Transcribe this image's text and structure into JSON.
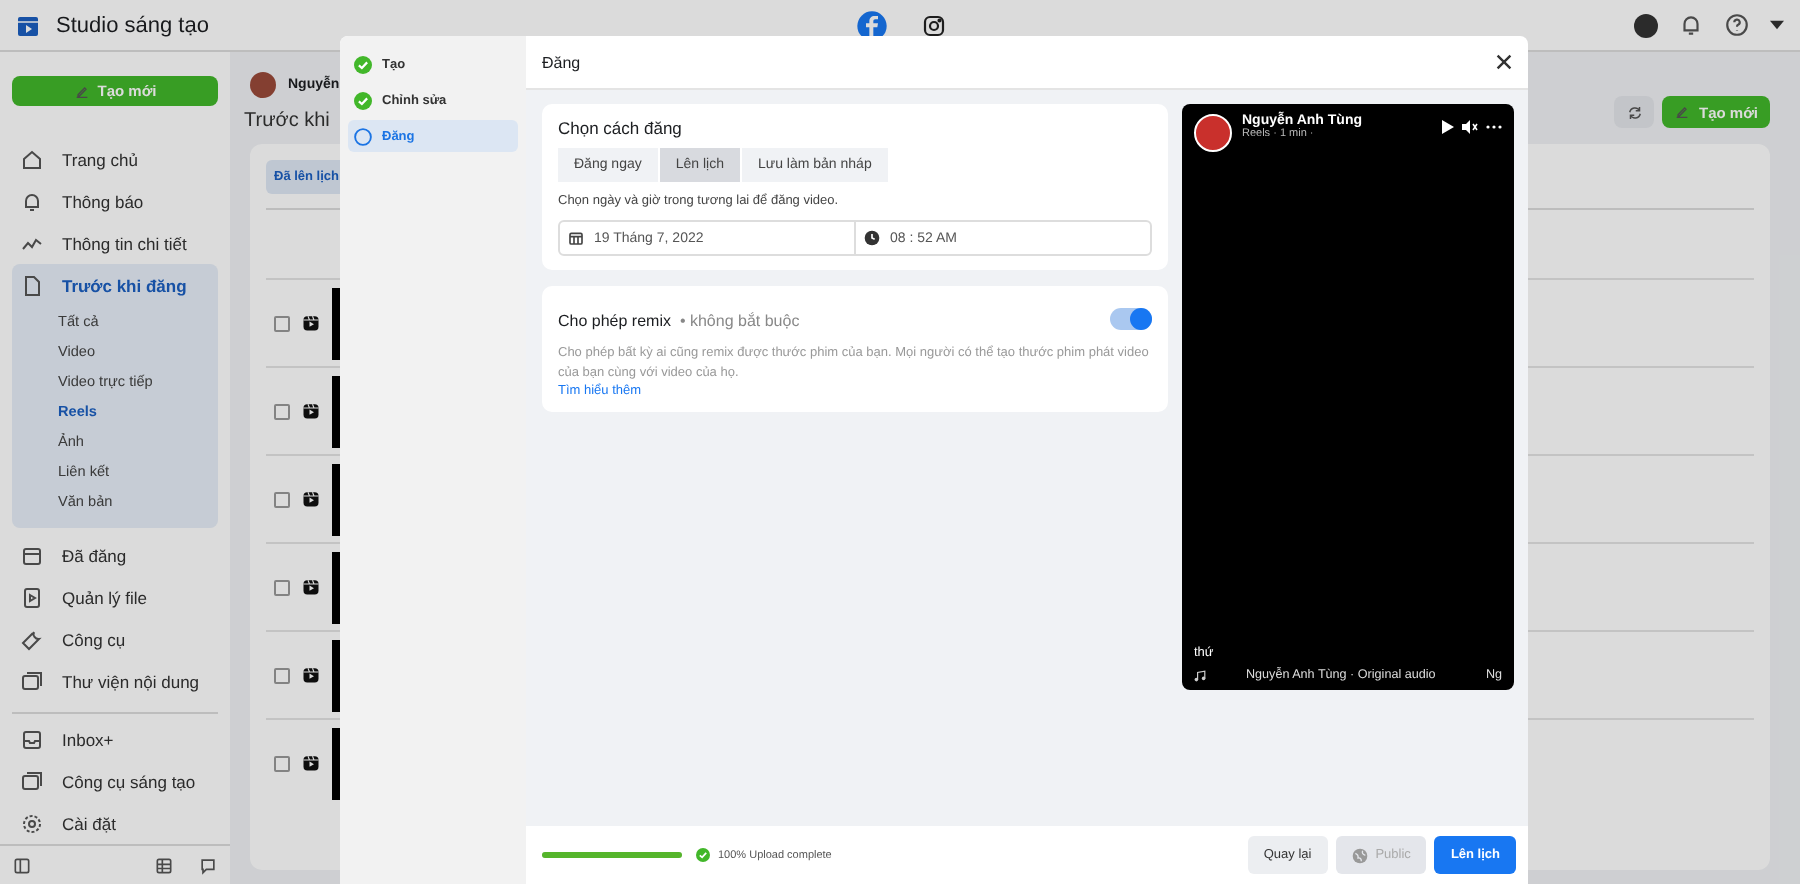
{
  "app_bar": {
    "title": "Studio sáng tạo"
  },
  "sidebar": {
    "create_button": "Tạo mới",
    "items": [
      {
        "label": "Trang chủ",
        "selected": false
      },
      {
        "label": "Thông báo",
        "selected": false
      },
      {
        "label": "Thông tin chi tiết",
        "selected": false
      },
      {
        "label": "Trước khi đăng",
        "selected": true,
        "children": [
          {
            "label": "Tất cả",
            "selected": false
          },
          {
            "label": "Video",
            "selected": false
          },
          {
            "label": "Video trực tiếp",
            "selected": false
          },
          {
            "label": "Reels",
            "selected": true
          },
          {
            "label": "Ảnh",
            "selected": false
          },
          {
            "label": "Liên kết",
            "selected": false
          },
          {
            "label": "Văn bản",
            "selected": false
          }
        ]
      },
      {
        "label": "Đã đăng",
        "selected": false
      },
      {
        "label": "Quản lý file",
        "selected": false
      },
      {
        "label": "Công cụ",
        "selected": false
      },
      {
        "label": "Thư viện nội dung",
        "selected": false
      }
    ],
    "tools": [
      {
        "label": "Inbox+"
      },
      {
        "label": "Công cụ sáng tạo"
      },
      {
        "label": "Cài đặt"
      }
    ]
  },
  "main": {
    "account_name": "Nguyễn",
    "title": "Trước khi",
    "tab": "Đã lên lịch",
    "create_button": "Tạo mới",
    "rows": [
      {
        "checked": false
      },
      {
        "checked": false
      },
      {
        "checked": false
      },
      {
        "checked": false
      },
      {
        "checked": false
      },
      {
        "checked": false
      }
    ]
  },
  "modal": {
    "steps": [
      {
        "label": "Tạo",
        "done": true,
        "selected": false
      },
      {
        "label": "Chỉnh sửa",
        "done": true,
        "selected": false
      },
      {
        "label": "Đăng",
        "done": false,
        "selected": true
      }
    ],
    "title": "Đăng",
    "publish": {
      "heading": "Chọn cách đăng",
      "options": [
        {
          "label": "Đăng ngay",
          "selected": false
        },
        {
          "label": "Lên lịch",
          "selected": true
        },
        {
          "label": "Lưu làm bản nháp",
          "selected": false
        }
      ],
      "hint": "Chọn ngày và giờ trong tương lai để đăng video.",
      "date": "19 Tháng 7, 2022",
      "time": "08 : 52 AM"
    },
    "remix": {
      "title": "Cho phép remix",
      "separator": "•",
      "note": "không bắt buộc",
      "description": "Cho phép bất kỳ ai cũng remix được thước phim của bạn. Mọi người có thể tạo thước phim phát video của bạn cùng với video của họ.",
      "link": "Tìm hiểu thêm",
      "on": true
    },
    "preview": {
      "author": "Nguyễn Anh Tùng",
      "meta": "Reels · 1 min ·",
      "caption": "thứ",
      "audio": "Nguyễn Anh Tùng · Original audio",
      "audio_tail": "Ng"
    },
    "footer": {
      "progress": {
        "level": 1.0,
        "status": "100% Upload complete"
      },
      "buttons": [
        {
          "label": "Quay lại",
          "kind": "secondary",
          "disabled": false
        },
        {
          "label": "Public",
          "kind": "audience",
          "disabled": true
        },
        {
          "label": "Lên lịch",
          "kind": "primary",
          "disabled": false
        }
      ]
    }
  }
}
